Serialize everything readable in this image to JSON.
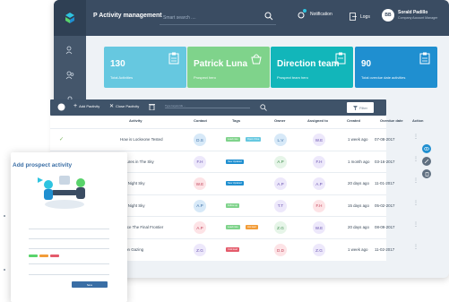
{
  "app": {
    "title": "P Activity management"
  },
  "topbar": {
    "search_placeholder": "Smart search ....",
    "notification_label": "Notification",
    "logout_label": "Logs",
    "user": {
      "initials": "BB",
      "name": "Sorald Padillo",
      "role": "Company Account Manager"
    }
  },
  "sidebar": {
    "icons": [
      "user-plus-icon",
      "users-icon",
      "person-icon",
      "user-group-icon",
      "card-list-icon"
    ]
  },
  "cards": [
    {
      "value": "130",
      "label": "Total Activities",
      "color": "#66c8e0",
      "icon": "clipboard-icon"
    },
    {
      "value": "Patrick Luna",
      "label": "Prospect hero",
      "color": "#7fd38b",
      "icon": "basket-icon"
    },
    {
      "value": "Direction team",
      "label": "Prospect team hero",
      "color": "#12b6ba",
      "icon": "clipboard-icon"
    },
    {
      "value": "90",
      "label": "Total overdue date activities",
      "color": "#1f8fd0",
      "icon": "clipboard-icon"
    }
  ],
  "toolbar": {
    "add_label": "Add Pactivity",
    "close_label": "Close Pactivity",
    "type_placeholder": "Type keywords ...",
    "filter_label": "Filter"
  },
  "table": {
    "headers": {
      "activity": "Activity",
      "contact": "Contact",
      "tags": "Tags",
      "owner": "Owner",
      "assigned": "Assigned to",
      "created": "Created",
      "overdue": "Overdue date",
      "action": "Action"
    },
    "rows": [
      {
        "activity": "How is Lockeone Tested",
        "contact": "D.S",
        "tags": [
          {
            "text": "Lead note",
            "color": "#7fd38b"
          },
          {
            "text": "Open / Due",
            "color": "#66c8e0"
          }
        ],
        "owner": "L.V",
        "assigned": "W.E",
        "created": "1 week ago",
        "overdue": "07-08-2017",
        "checked": true
      },
      {
        "activity": "Pictures in The Sky",
        "contact": "F.H",
        "tags": [
          {
            "text": "New Updated",
            "color": "#1f8fd0"
          }
        ],
        "owner": "A.P",
        "assigned": "F.H",
        "created": "1 month ago",
        "overdue": "03-16-2017",
        "checked": false
      },
      {
        "activity": "The Night Sky",
        "contact": "W.E",
        "tags": [
          {
            "text": "New Updated",
            "color": "#1f8fd0"
          }
        ],
        "owner": "A.P",
        "assigned": "A.P",
        "created": "20 days ago",
        "overdue": "11-01-2017",
        "checked": false
      },
      {
        "activity": "The Night Sky",
        "contact": "A.P",
        "tags": [
          {
            "text": "Follow up",
            "color": "#7fd38b"
          }
        ],
        "owner": "T.T",
        "assigned": "F.H",
        "created": "15 days ago",
        "overdue": "05-02-2017",
        "checked": false
      },
      {
        "activity": "Space The Final Frontier",
        "contact": "A.P",
        "tags": [
          {
            "text": "Lead note",
            "color": "#7fd38b"
          },
          {
            "text": "Hot lead",
            "color": "#f29c38"
          }
        ],
        "owner": "Z.G",
        "assigned": "W.E",
        "created": "20 days ago",
        "overdue": "08-09-2017",
        "checked": false
      },
      {
        "activity": "Moon Gazing",
        "contact": "Z.G",
        "tags": [
          {
            "text": "Cold lead",
            "color": "#e45b6b"
          }
        ],
        "owner": "D.D",
        "assigned": "Z.G",
        "created": "1 week ago",
        "overdue": "11-02-2017",
        "checked": false
      }
    ]
  },
  "form": {
    "title": "Add prospect activity",
    "submit_label": "Save"
  },
  "colors": {
    "topbar": "#3a4c62",
    "sidebar": "#44566b",
    "accent": "#3a6ea5"
  }
}
